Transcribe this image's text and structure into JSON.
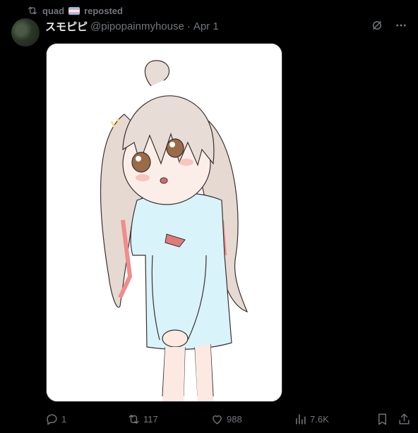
{
  "repost": {
    "user": "quad",
    "flag_icon": "transgender-flag",
    "label": "reposted"
  },
  "author": {
    "display_name": "スモピピ",
    "handle": "@pipopainmyhouse",
    "separator": "·",
    "date": "Apr 1"
  },
  "media": {
    "description_icon": "anime-girl-illustration"
  },
  "actions": {
    "replies": "1",
    "reposts": "117",
    "likes": "988",
    "views": "7.6K"
  },
  "colors": {
    "background": "#000000",
    "text_primary": "#e7e9ea",
    "text_secondary": "#71767b"
  }
}
